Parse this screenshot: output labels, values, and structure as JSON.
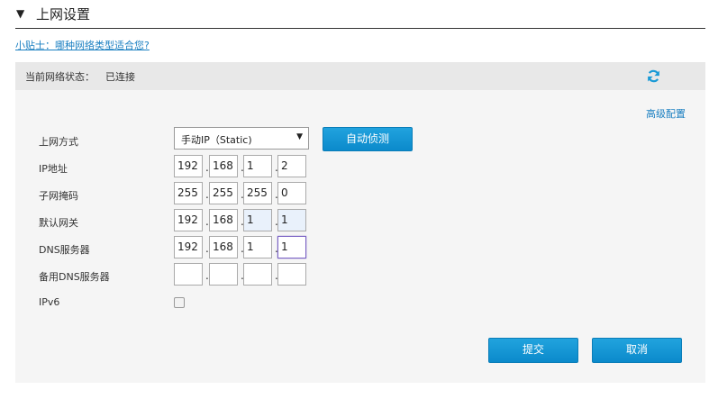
{
  "header": {
    "title": "上网设置",
    "collapse_icon": "triangle-down-icon"
  },
  "tip_link": "小贴士：哪种网络类型适合您?",
  "status": {
    "label": "当前网络状态：",
    "value": "已连接",
    "refresh_icon": "refresh-icon"
  },
  "advanced_link": "高级配置",
  "form": {
    "mode_label": "上网方式",
    "mode_value": "手动IP（Static)",
    "auto_detect_label": "自动侦测",
    "ip_label": "IP地址",
    "ip_octets": [
      "192",
      "168",
      "1",
      "2"
    ],
    "mask_label": "子网掩码",
    "mask_octets": [
      "255",
      "255",
      "255",
      "0"
    ],
    "gateway_label": "默认网关",
    "gateway_octets": [
      "192",
      "168",
      "1",
      "1"
    ],
    "dns_label": "DNS服务器",
    "dns_octets": [
      "192",
      "168",
      "1",
      "1"
    ],
    "alt_dns_label": "备用DNS服务器",
    "alt_dns_octets": [
      "",
      "",
      "",
      ""
    ],
    "ipv6_label": "IPv6",
    "ipv6_checked": false
  },
  "actions": {
    "submit_label": "提交",
    "cancel_label": "取消"
  },
  "colors": {
    "accent": "#1a9ad6",
    "link": "#1a7fc1",
    "status_bar": "#e8e8e8",
    "panel": "#f5f5f5"
  }
}
